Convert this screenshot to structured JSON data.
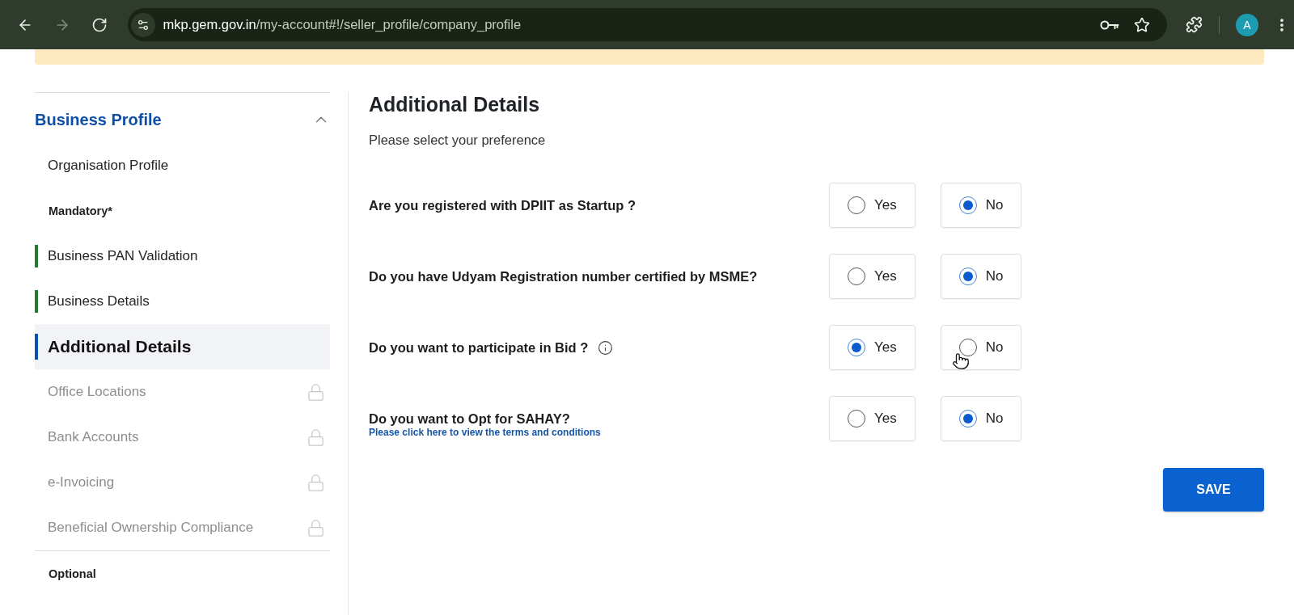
{
  "browser": {
    "nav_buttons": [
      {
        "kind": "back",
        "disabled": false
      },
      {
        "kind": "forward",
        "disabled": true
      },
      {
        "kind": "reload",
        "disabled": false
      }
    ],
    "url": {
      "host": "mkp.gem.gov.in",
      "path": "/my-account#!/seller_profile/company_profile"
    },
    "profile_initial": "A"
  },
  "sidebar": {
    "section": {
      "title": "Business Profile",
      "expanded": true
    },
    "items": [
      {
        "kind": "link",
        "label": "Organisation Profile",
        "selected": false,
        "completed": false,
        "locked": false
      },
      {
        "kind": "heading",
        "label": "Mandatory*",
        "divider": false
      },
      {
        "kind": "link",
        "label": "Business PAN Validation",
        "selected": false,
        "completed": true,
        "locked": false
      },
      {
        "kind": "link",
        "label": "Business Details",
        "selected": false,
        "completed": true,
        "locked": false
      },
      {
        "kind": "link",
        "label": "Additional Details",
        "selected": true,
        "completed": false,
        "locked": false
      },
      {
        "kind": "link",
        "label": "Office Locations",
        "selected": false,
        "completed": false,
        "locked": true
      },
      {
        "kind": "link",
        "label": "Bank Accounts",
        "selected": false,
        "completed": false,
        "locked": true
      },
      {
        "kind": "link",
        "label": "e-Invoicing",
        "selected": false,
        "completed": false,
        "locked": true
      },
      {
        "kind": "link",
        "label": "Beneficial Ownership Compliance",
        "selected": false,
        "completed": false,
        "locked": true
      },
      {
        "kind": "heading",
        "label": "Optional",
        "divider": true
      }
    ]
  },
  "main": {
    "title": "Additional Details",
    "subtitle": "Please select your preference",
    "questions": [
      {
        "text": "Are you registered with DPIIT as Startup ?",
        "info": false,
        "options": [
          {
            "label": "Yes",
            "selected": false,
            "hovered": false
          },
          {
            "label": "No",
            "selected": true,
            "hovered": false
          }
        ]
      },
      {
        "text": "Do you have Udyam Registration number certified by MSME?",
        "info": false,
        "options": [
          {
            "label": "Yes",
            "selected": false,
            "hovered": false
          },
          {
            "label": "No",
            "selected": true,
            "hovered": false
          }
        ]
      },
      {
        "text": "Do you want to participate in Bid ?",
        "info": true,
        "options": [
          {
            "label": "Yes",
            "selected": true,
            "hovered": false
          },
          {
            "label": "No",
            "selected": false,
            "hovered": true
          }
        ]
      },
      {
        "text": "Do you want to Opt for SAHAY?",
        "info": false,
        "link": "Please click here to view the terms and conditions",
        "options": [
          {
            "label": "Yes",
            "selected": false,
            "hovered": false
          },
          {
            "label": "No",
            "selected": true,
            "hovered": false
          }
        ]
      }
    ],
    "save_button": "SAVE"
  }
}
